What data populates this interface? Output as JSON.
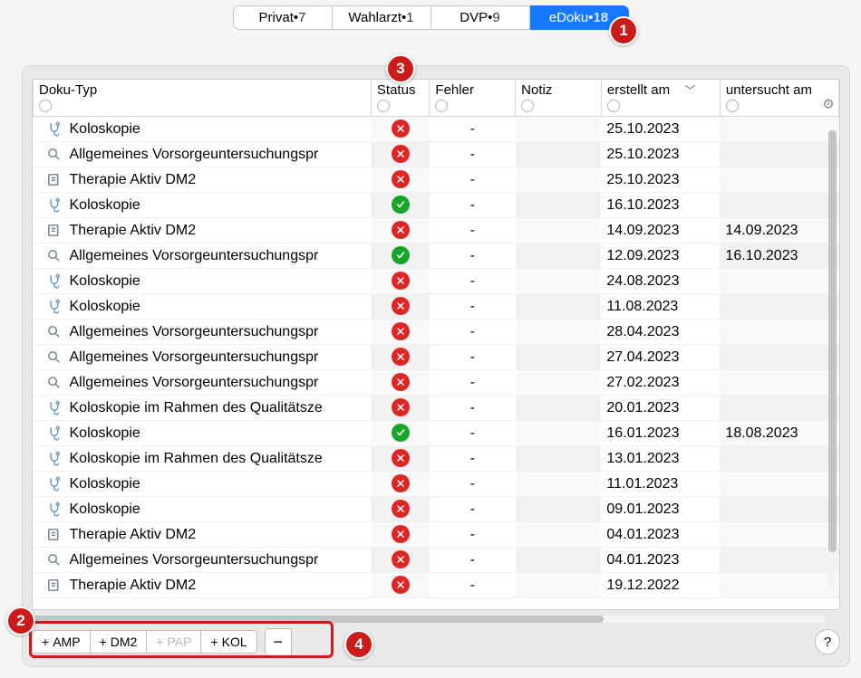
{
  "tabs": [
    {
      "label": "Privat",
      "count": "7",
      "active": false
    },
    {
      "label": "Wahlarzt",
      "count": "1",
      "active": false
    },
    {
      "label": "DVP",
      "count": "9",
      "active": false
    },
    {
      "label": "eDoku",
      "count": "18",
      "active": true
    }
  ],
  "columns": {
    "typ": "Doku-Typ",
    "status": "Status",
    "fehler": "Fehler",
    "notiz": "Notiz",
    "erstellt": "erstellt am",
    "untersucht": "untersucht am"
  },
  "rows": [
    {
      "icon": "scope",
      "typ": "Koloskopie",
      "status": "err",
      "fehler": "-",
      "notiz": "",
      "erstellt": "25.10.2023",
      "untersucht": ""
    },
    {
      "icon": "lens",
      "typ": "Allgemeines Vorsorgeuntersuchungspr",
      "status": "err",
      "fehler": "-",
      "notiz": "",
      "erstellt": "25.10.2023",
      "untersucht": ""
    },
    {
      "icon": "note",
      "typ": "Therapie Aktiv DM2",
      "status": "err",
      "fehler": "-",
      "notiz": "",
      "erstellt": "25.10.2023",
      "untersucht": ""
    },
    {
      "icon": "scope",
      "typ": "Koloskopie",
      "status": "ok",
      "fehler": "-",
      "notiz": "",
      "erstellt": "16.10.2023",
      "untersucht": ""
    },
    {
      "icon": "note",
      "typ": "Therapie Aktiv DM2",
      "status": "err",
      "fehler": "-",
      "notiz": "",
      "erstellt": "14.09.2023",
      "untersucht": "14.09.2023"
    },
    {
      "icon": "lens",
      "typ": "Allgemeines Vorsorgeuntersuchungspr",
      "status": "ok",
      "fehler": "-",
      "notiz": "",
      "erstellt": "12.09.2023",
      "untersucht": "16.10.2023"
    },
    {
      "icon": "scope",
      "typ": "Koloskopie",
      "status": "err",
      "fehler": "-",
      "notiz": "",
      "erstellt": "24.08.2023",
      "untersucht": ""
    },
    {
      "icon": "scope",
      "typ": "Koloskopie",
      "status": "err",
      "fehler": "-",
      "notiz": "",
      "erstellt": "11.08.2023",
      "untersucht": ""
    },
    {
      "icon": "lens",
      "typ": "Allgemeines Vorsorgeuntersuchungspr",
      "status": "err",
      "fehler": "-",
      "notiz": "",
      "erstellt": "28.04.2023",
      "untersucht": ""
    },
    {
      "icon": "lens",
      "typ": "Allgemeines Vorsorgeuntersuchungspr",
      "status": "err",
      "fehler": "-",
      "notiz": "",
      "erstellt": "27.04.2023",
      "untersucht": ""
    },
    {
      "icon": "lens",
      "typ": "Allgemeines Vorsorgeuntersuchungspr",
      "status": "err",
      "fehler": "-",
      "notiz": "",
      "erstellt": "27.02.2023",
      "untersucht": ""
    },
    {
      "icon": "scope",
      "typ": "Koloskopie im Rahmen des Qualitätsze",
      "status": "err",
      "fehler": "-",
      "notiz": "",
      "erstellt": "20.01.2023",
      "untersucht": ""
    },
    {
      "icon": "scope",
      "typ": "Koloskopie",
      "status": "ok",
      "fehler": "-",
      "notiz": "",
      "erstellt": "16.01.2023",
      "untersucht": "18.08.2023"
    },
    {
      "icon": "scope",
      "typ": "Koloskopie im Rahmen des Qualitätsze",
      "status": "err",
      "fehler": "-",
      "notiz": "",
      "erstellt": "13.01.2023",
      "untersucht": ""
    },
    {
      "icon": "scope",
      "typ": "Koloskopie",
      "status": "err",
      "fehler": "-",
      "notiz": "",
      "erstellt": "11.01.2023",
      "untersucht": ""
    },
    {
      "icon": "scope",
      "typ": "Koloskopie",
      "status": "err",
      "fehler": "-",
      "notiz": "",
      "erstellt": "09.01.2023",
      "untersucht": ""
    },
    {
      "icon": "note",
      "typ": "Therapie Aktiv DM2",
      "status": "err",
      "fehler": "-",
      "notiz": "",
      "erstellt": "04.01.2023",
      "untersucht": ""
    },
    {
      "icon": "lens",
      "typ": "Allgemeines Vorsorgeuntersuchungspr",
      "status": "err",
      "fehler": "-",
      "notiz": "",
      "erstellt": "04.01.2023",
      "untersucht": ""
    },
    {
      "icon": "note",
      "typ": "Therapie Aktiv DM2",
      "status": "err",
      "fehler": "-",
      "notiz": "",
      "erstellt": "19.12.2022",
      "untersucht": ""
    }
  ],
  "toolbar": {
    "add": [
      {
        "label": "AMP",
        "enabled": true
      },
      {
        "label": "DM2",
        "enabled": true
      },
      {
        "label": "PAP",
        "enabled": false
      },
      {
        "label": "KOL",
        "enabled": true
      }
    ],
    "minus": "−",
    "help": "?"
  },
  "callouts": {
    "1": "1",
    "2": "2",
    "3": "3",
    "4": "4"
  }
}
